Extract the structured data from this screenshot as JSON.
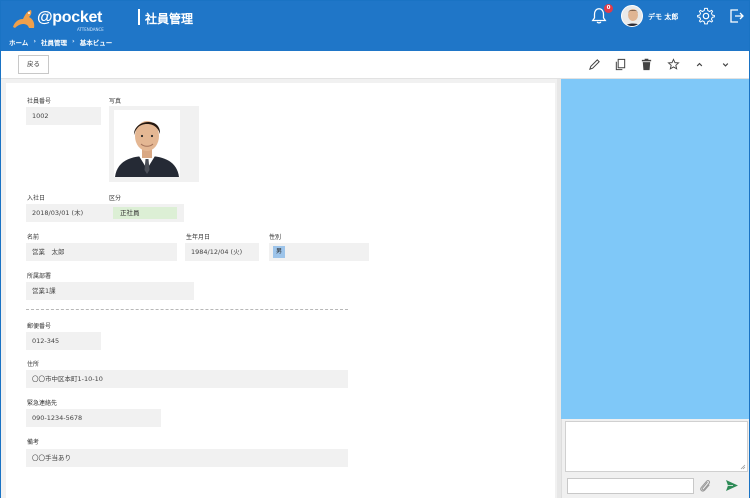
{
  "header": {
    "logo_text": "@pocket",
    "logo_sub": "ATTENDANCE",
    "title": "社員管理",
    "notification_count": "0",
    "user_name": "デモ 太郎"
  },
  "breadcrumb": {
    "items": [
      "ホーム",
      "社員管理",
      "基本ビュー"
    ],
    "sep": "›"
  },
  "toolbar": {
    "back_label": "戻る"
  },
  "form": {
    "employee_no_label": "社員番号",
    "employee_no": "1002",
    "photo_label": "写真",
    "join_date_label": "入社日",
    "join_date": "2018/03/01 (木)",
    "category_label": "区分",
    "category": "正社員",
    "name_label": "名前",
    "name": "営業　太郎",
    "birthday_label": "生年月日",
    "birthday": "1984/12/04 (火)",
    "gender_label": "性別",
    "gender": "男",
    "department_label": "所属部署",
    "department": "営業1課",
    "postal_label": "郵便番号",
    "postal": "012-345",
    "address_label": "住所",
    "address": "〇〇市中区本町1-10-10",
    "emergency_label": "緊急連絡先",
    "emergency": "090-1234-5678",
    "note_label": "備考",
    "note": "〇〇手当あり"
  },
  "colors": {
    "header_bg": "#1f76c8",
    "side_panel": "#7fc8f8",
    "badge": "#e03b4a",
    "send_icon": "#2e8b57"
  }
}
